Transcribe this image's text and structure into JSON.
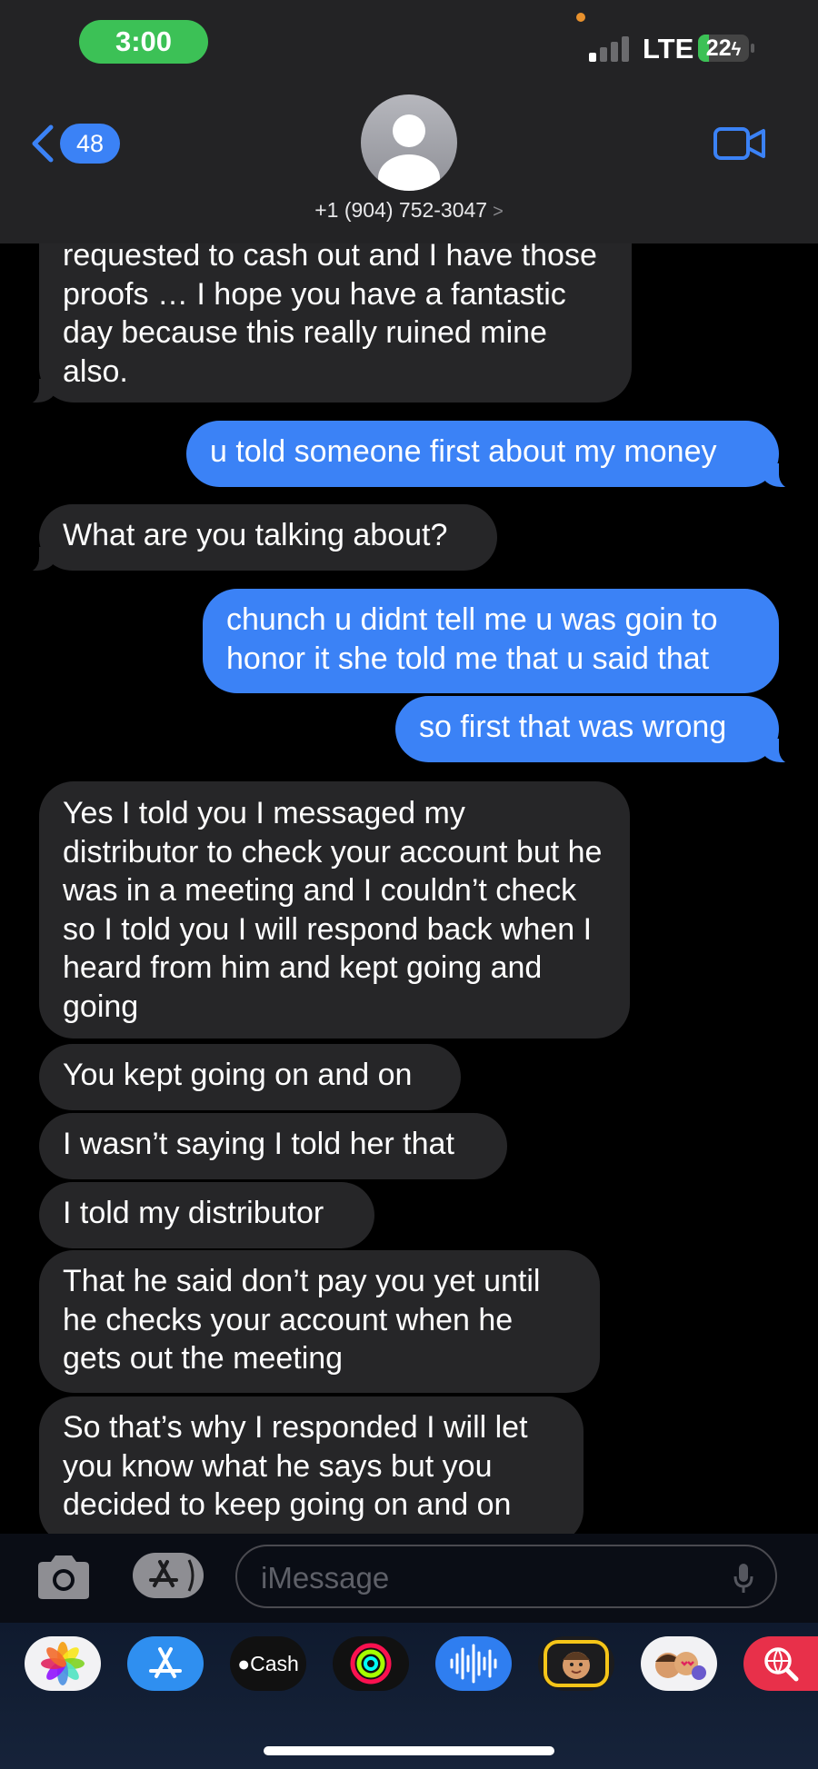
{
  "status_bar": {
    "time": "3:00",
    "network": "LTE",
    "battery_percent": "22",
    "battery_level": 0.22
  },
  "header": {
    "back_count": "48",
    "contact": "+1 (904) 752-3047",
    "contact_chevron": ">",
    "icons": [
      "chevron-left-icon",
      "person-avatar-icon",
      "video-camera-icon"
    ]
  },
  "messages": [
    {
      "direction": "in",
      "text": "requested to cash out and I have those proofs … I hope you have a fantastic day because this really ruined mine also."
    },
    {
      "direction": "out",
      "text": "u told someone first about my money"
    },
    {
      "direction": "in",
      "text": "What are you talking about?"
    },
    {
      "direction": "out",
      "text": "chunch u didnt tell me u was goin to honor it she told me that u said that"
    },
    {
      "direction": "out",
      "text": "so first that was wrong"
    },
    {
      "direction": "in",
      "text": "Yes I told you I messaged my distributor to check your account but he was in a meeting and I couldn’t check so I told you I will respond back when I heard from him and kept going and going"
    },
    {
      "direction": "in",
      "text": "You kept going on and on"
    },
    {
      "direction": "in",
      "text": "I wasn’t saying I told her that"
    },
    {
      "direction": "in",
      "text": "I told my distributor"
    },
    {
      "direction": "in",
      "text": "That he said don’t pay you yet until he checks your account when he gets out the meeting"
    },
    {
      "direction": "in",
      "text": "So that’s why I responded I will let you know what he says but you decided to keep going on and on"
    }
  ],
  "input": {
    "placeholder": "iMessage",
    "icons": [
      "camera-icon",
      "app-store-icon",
      "microphone-icon"
    ]
  },
  "app_drawer": {
    "apps": [
      {
        "name": "photos-app-icon"
      },
      {
        "name": "app-store-app-icon"
      },
      {
        "name": "apple-cash-app-icon",
        "label": "Cash"
      },
      {
        "name": "fitness-activity-app-icon"
      },
      {
        "name": "audio-message-app-icon"
      },
      {
        "name": "memoji-app-icon"
      },
      {
        "name": "memoji-stickers-app-icon"
      },
      {
        "name": "image-search-app-icon"
      }
    ]
  },
  "colors": {
    "incoming_bubble": "#262628",
    "outgoing_bubble": "#3b82f6",
    "accent": "#3b82f6",
    "time_pill": "#3cc156",
    "background": "#000000"
  }
}
